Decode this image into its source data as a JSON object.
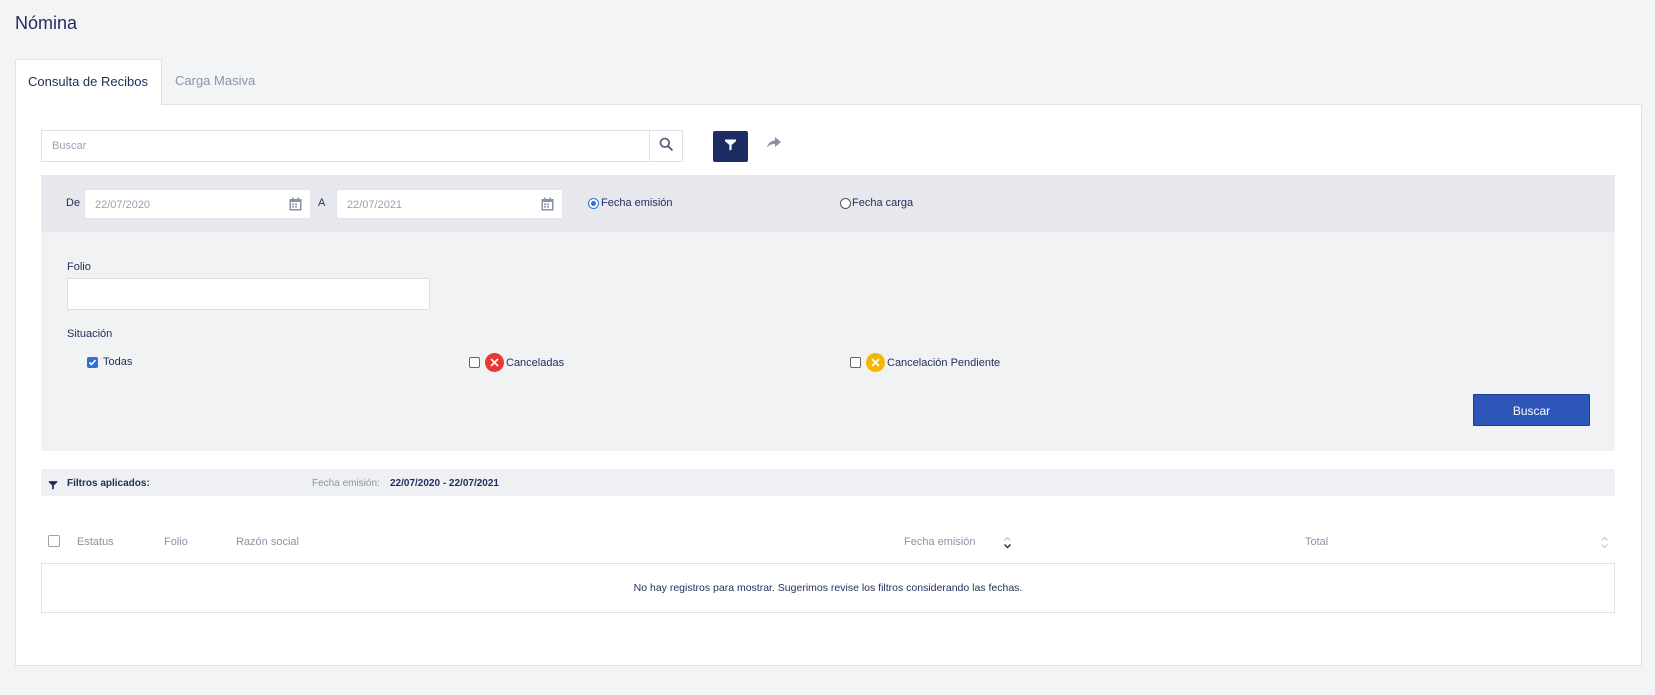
{
  "page": {
    "title": "Nómina"
  },
  "tabs": [
    {
      "label": "Consulta de Recibos",
      "active": true
    },
    {
      "label": "Carga Masiva",
      "active": false
    }
  ],
  "search": {
    "placeholder": "Buscar",
    "value": ""
  },
  "icons": {
    "search": "search-icon",
    "filter": "filter-icon",
    "share": "share-arrow-icon",
    "calendar": "calendar-icon",
    "cancel_red": "x-circle-icon",
    "cancel_yellow": "x-circle-icon"
  },
  "colors": {
    "primary_dark": "#1d2d63",
    "primary_button": "#2e55b8",
    "canceled": "#e53935",
    "pending": "#f5b800",
    "text": "#1f2d5a",
    "muted": "#8a93a6"
  },
  "date_filter": {
    "from_label": "De",
    "from_value": "22/07/2020",
    "to_label": "A",
    "to_value": "22/07/2021",
    "options": [
      {
        "label": "Fecha emisión",
        "selected": true
      },
      {
        "label": "Fecha carga",
        "selected": false
      }
    ]
  },
  "folio": {
    "label": "Folio",
    "value": ""
  },
  "situacion": {
    "label": "Situación",
    "options": [
      {
        "label": "Todas",
        "checked": true
      },
      {
        "label": "Canceladas",
        "checked": false
      },
      {
        "label": "Cancelación Pendiente",
        "checked": false
      }
    ]
  },
  "buscar_button": "Buscar",
  "applied_filters": {
    "label": "Filtros aplicados:",
    "key": "Fecha emisión:",
    "value": "22/07/2020 - 22/07/2021"
  },
  "table": {
    "columns": [
      "Estatus",
      "Folio",
      "Razón social",
      "Fecha emisión",
      "Total"
    ],
    "rows": [],
    "empty_message": "No hay registros para mostrar. Sugerimos revise los filtros considerando las fechas."
  }
}
